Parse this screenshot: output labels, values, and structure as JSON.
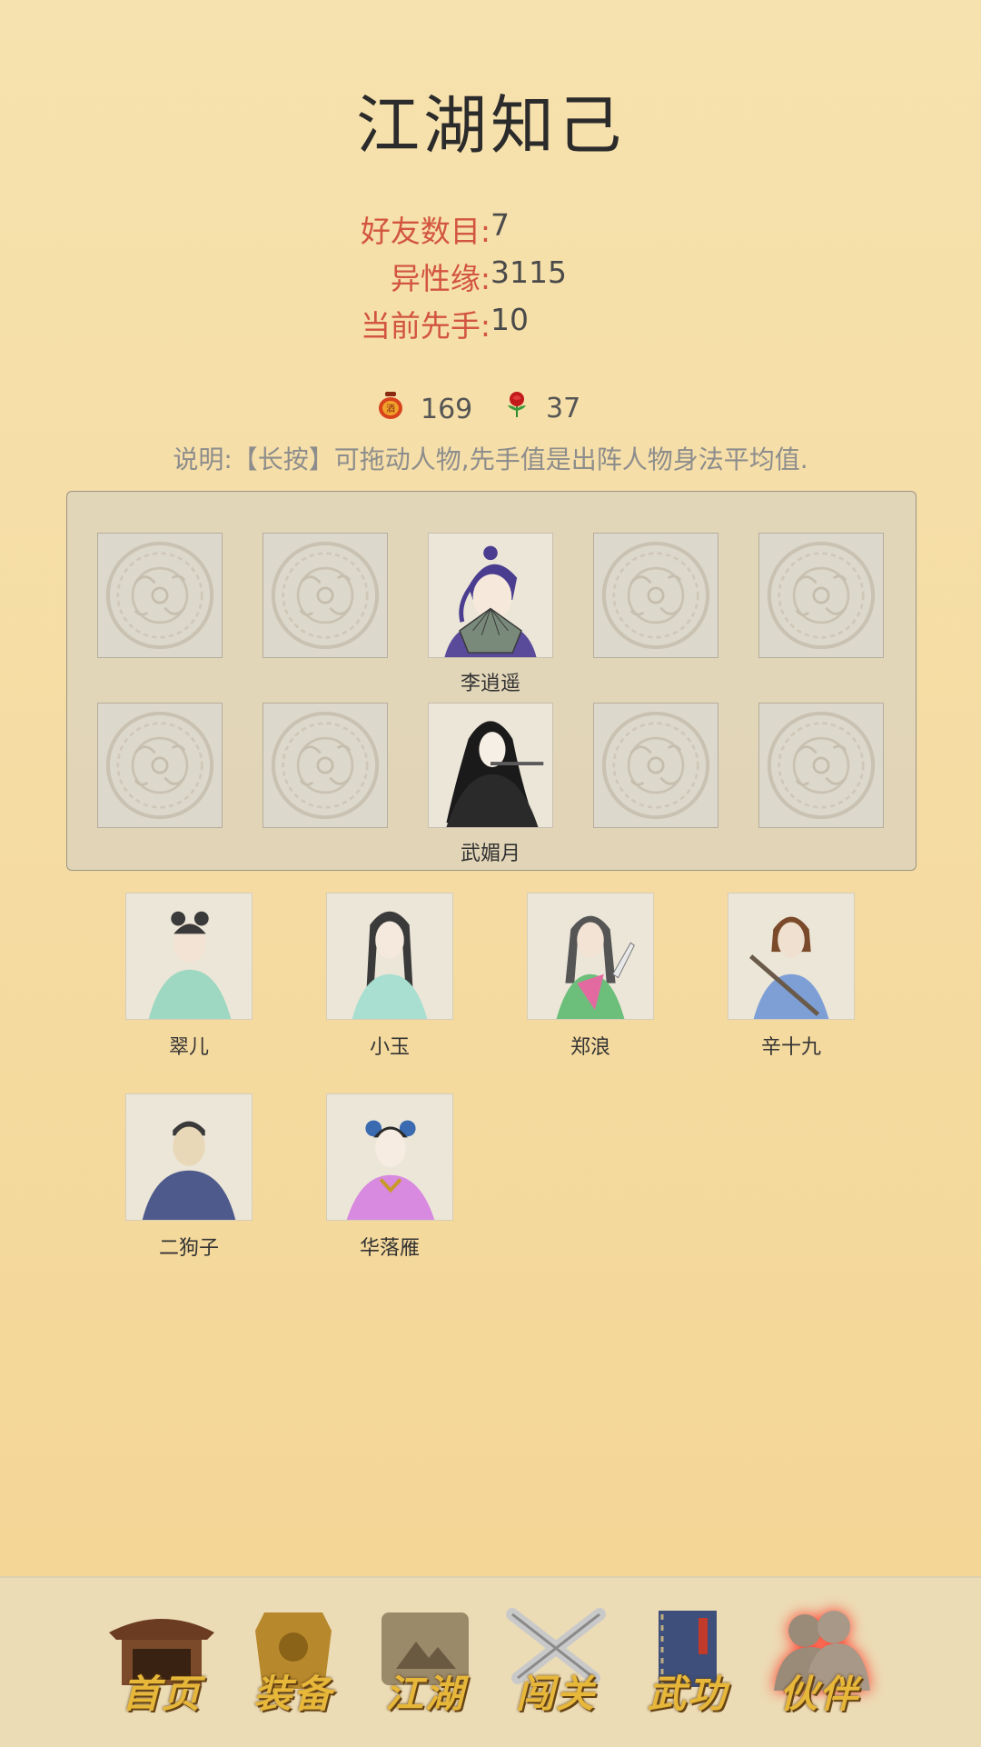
{
  "page": {
    "title": "江湖知己"
  },
  "stats": [
    {
      "label": "好友数目:",
      "value": "7"
    },
    {
      "label": "异性缘:",
      "value": "3115"
    },
    {
      "label": "当前先手:",
      "value": "10"
    }
  ],
  "currency": [
    {
      "icon": "wine-jar-icon",
      "value": "169"
    },
    {
      "icon": "rose-icon",
      "value": "37"
    }
  ],
  "note": "说明:【长按】可拖动人物,先手值是出阵人物身法平均值.",
  "formation": {
    "rows": [
      {
        "slots": [
          "",
          "",
          "李逍遥",
          "",
          ""
        ]
      },
      {
        "slots": [
          "",
          "",
          "武媚月",
          "",
          ""
        ]
      }
    ]
  },
  "bench": [
    {
      "name": "翠儿"
    },
    {
      "name": "小玉"
    },
    {
      "name": "郑浪"
    },
    {
      "name": "辛十九"
    },
    {
      "name": "二狗子"
    },
    {
      "name": "华落雁"
    }
  ],
  "nav": [
    {
      "label": "首页",
      "icon": "pavilion-icon"
    },
    {
      "label": "装备",
      "icon": "armor-icon"
    },
    {
      "label": "江湖",
      "icon": "scroll-map-icon"
    },
    {
      "label": "闯关",
      "icon": "crossed-swords-icon"
    },
    {
      "label": "武功",
      "icon": "manual-book-icon"
    },
    {
      "label": "伙伴",
      "icon": "companions-icon",
      "active": true
    }
  ],
  "colors": {
    "accent_red": "#d2553f",
    "nav_gold": "#e7b73a"
  }
}
